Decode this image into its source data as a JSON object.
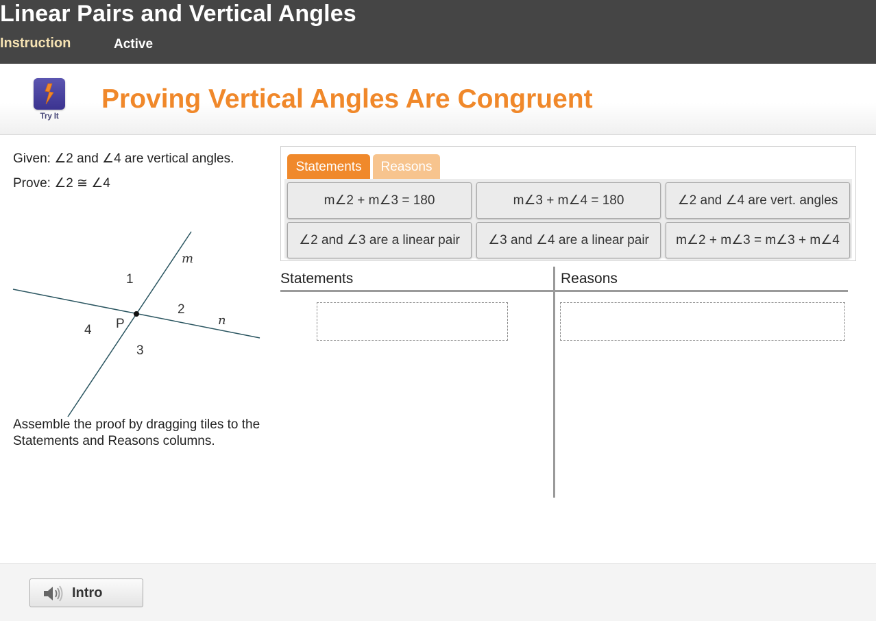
{
  "header": {
    "course_title": "Linear Pairs and Vertical Angles",
    "tabs": [
      {
        "label": "Instruction"
      },
      {
        "label": "Active"
      }
    ]
  },
  "lesson": {
    "icon_name": "lightning-icon",
    "icon_label": "Try It",
    "title": "Proving Vertical Angles Are Congruent"
  },
  "problem": {
    "given": "Given: ∠2 and ∠4 are vertical angles.",
    "prove": "Prove: ∠2 ≅ ∠4",
    "instructions": "Assemble the proof by dragging tiles to the Statements and Reasons columns."
  },
  "diagram": {
    "line_labels": [
      "m",
      "n"
    ],
    "angle_labels": [
      "1",
      "2",
      "3",
      "4"
    ],
    "point_label": "P"
  },
  "tile_bank": {
    "tabs": [
      {
        "label": "Statements",
        "active": true
      },
      {
        "label": "Reasons",
        "active": false
      }
    ],
    "tiles": [
      {
        "prefix": "",
        "text": "m∠2 + m∠3 = 180"
      },
      {
        "prefix": "",
        "text": "m∠3 + m∠4 = 180"
      },
      {
        "prefix": "",
        "text": "∠2 and ∠4 are vert. angles"
      },
      {
        "prefix": "",
        "text": "∠2 and ∠3 are a linear pair"
      },
      {
        "prefix": "",
        "text": "∠3 and ∠4 are a linear pair"
      },
      {
        "prefix": "",
        "text": "m∠2 + m∠3 = m∠3 + m∠4"
      }
    ]
  },
  "proof_table": {
    "statements_header": "Statements",
    "reasons_header": "Reasons"
  },
  "footer": {
    "intro_label": "Intro"
  },
  "colors": {
    "accent_orange": "#f0882a",
    "tab_inactive": "#f7c48e",
    "header_bg": "#454545",
    "nav_highlight": "#f6e3b3",
    "icon_purple": "#4b44a3"
  }
}
